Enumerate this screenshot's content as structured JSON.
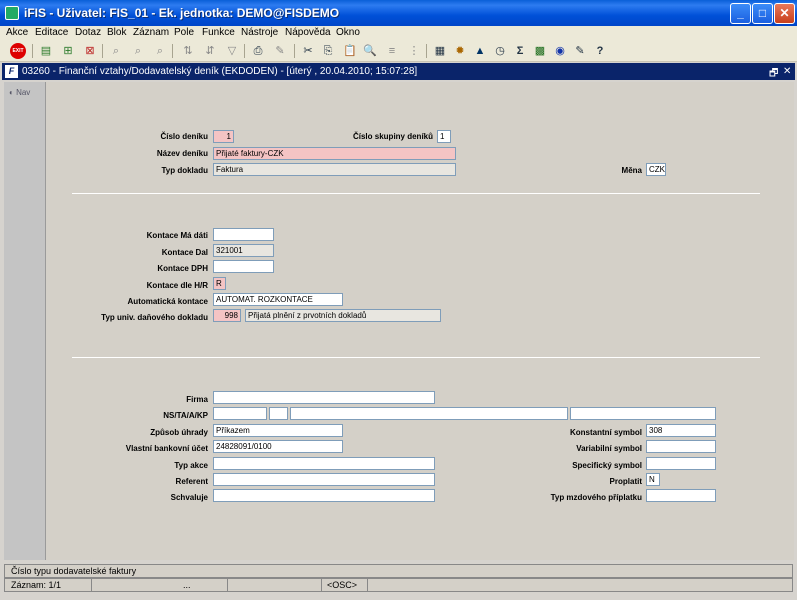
{
  "window": {
    "title": "iFIS - Uživatel: FIS_01 - Ek. jednotka: DEMO@FISDEMO",
    "minimize": "_",
    "maximize": "□",
    "close": "✕"
  },
  "menu": [
    "Akce",
    "Editace",
    "Dotaz",
    "Blok",
    "Záznam",
    "Pole",
    "Funkce",
    "Nástroje",
    "Nápověda",
    "Okno"
  ],
  "toolbar": {
    "exit_label": "EXIT",
    "icons": [
      "save-icon",
      "print-icon",
      "sort-asc-icon",
      "sort-desc-icon",
      "filter-icon",
      "cut-icon",
      "copy-icon",
      "paste-icon",
      "calculator-icon",
      "sum-icon",
      "excel-icon",
      "help-icon"
    ]
  },
  "inner_window": {
    "title": "03260 - Finanční vztahy/Dodavatelský deník (EKDODEN) - [úterý , 20.04.2010; 15:07:28]",
    "restore": "🗗",
    "close": "✕"
  },
  "nav": {
    "label": "Nav"
  },
  "section1": {
    "cislo_deniku_label": "Číslo deníku",
    "cislo_deniku_value": "1",
    "cislo_skupiny_label": "Číslo skupiny deníků",
    "cislo_skupiny_value": "1",
    "nazev_deniku_label": "Název deníku",
    "nazev_deniku_value": "Přijaté faktury-CZK",
    "typ_dokladu_label": "Typ dokladu",
    "typ_dokladu_value": "Faktura",
    "mena_label": "Měna",
    "mena_value": "CZK"
  },
  "section2": {
    "kontace_ma_dati_label": "Kontace Má dáti",
    "kontace_ma_dati_value": "",
    "kontace_dal_label": "Kontace Dal",
    "kontace_dal_value": "321001",
    "kontace_dph_label": "Kontace DPH",
    "kontace_dph_value": "",
    "kontace_hr_label": "Kontace dle H/R",
    "kontace_hr_value": "R",
    "automaticka_kontace_label": "Automatická kontace",
    "automaticka_kontace_value": "AUTOMAT. ROZKONTACE",
    "typ_univ_label": "Typ univ. daňového dokladu",
    "typ_univ_code": "998",
    "typ_univ_desc": "Přijatá plnění z prvotních dokladů"
  },
  "section3": {
    "firma_label": "Firma",
    "firma_value": "",
    "ns_label": "NS/TA/A/KP",
    "zpusob_uhrady_label": "Způsob úhrady",
    "zpusob_uhrady_value": "Příkazem",
    "vlastni_ucet_label": "Vlastní bankovní účet",
    "vlastni_ucet_value": "24828091/0100",
    "typ_akce_label": "Typ akce",
    "typ_akce_value": "",
    "referent_label": "Referent",
    "referent_value": "",
    "schvaluje_label": "Schvaluje",
    "schvaluje_value": "",
    "konstantni_symbol_label": "Konstantní symbol",
    "konstantni_symbol_value": "308",
    "variabilni_symbol_label": "Variabilní symbol",
    "variabilni_symbol_value": "",
    "specificky_symbol_label": "Specifický symbol",
    "specificky_symbol_value": "",
    "proplatit_label": "Proplatit",
    "proplatit_value": "N",
    "typ_mzdoveho_label": "Typ mzdového příplatku",
    "typ_mzdoveho_value": ""
  },
  "status": {
    "hint": "Číslo typu dodavatelské faktury",
    "record": "Záznam: 1/1",
    "dots": "...",
    "osc": "<OSC>"
  }
}
